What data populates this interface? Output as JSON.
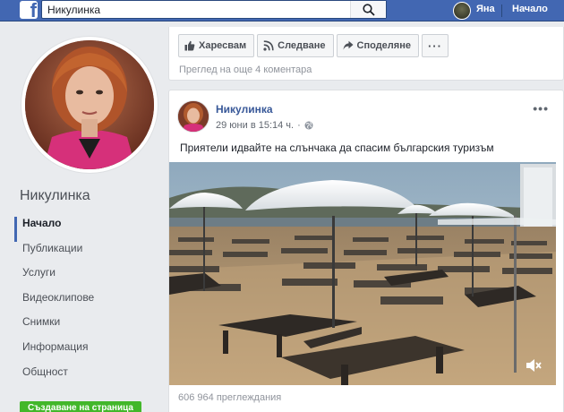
{
  "topbar": {
    "search_value": "Никулинка",
    "user_name": "Яна",
    "home_label": "Начало"
  },
  "page": {
    "name": "Никулинка",
    "nav": [
      {
        "label": "Начало",
        "active": true
      },
      {
        "label": "Публикации"
      },
      {
        "label": "Услуги"
      },
      {
        "label": "Видеоклипове"
      },
      {
        "label": "Снимки"
      },
      {
        "label": "Информация"
      },
      {
        "label": "Общност"
      }
    ],
    "create_page_label": "Създаване на страница"
  },
  "prev_post": {
    "like_label": "Харесвам",
    "follow_label": "Следване",
    "share_label": "Споделяне",
    "more_label": "···",
    "more_comments": "Преглед на още 4 коментара"
  },
  "post": {
    "author": "Никулинка",
    "date": "29 юни в 15:14 ч.",
    "separator": "·",
    "text": "Приятели идвайте на слънчака да спасим българския туризъм",
    "views": "606 964 преглеждания",
    "menu": "•••"
  },
  "colors": {
    "brand": "#4267b2",
    "link": "#385898",
    "create_button": "#42b72a"
  }
}
